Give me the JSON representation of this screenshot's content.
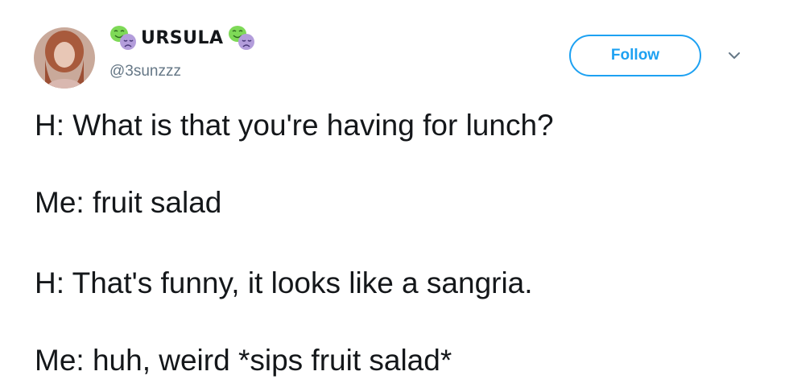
{
  "user": {
    "display_name": "URSULA",
    "handle": "@3sunzzz",
    "name_icons": [
      "theater-masks-icon",
      "theater-masks-icon"
    ]
  },
  "actions": {
    "follow_label": "Follow",
    "more_icon": "chevron-down-icon"
  },
  "tweet": {
    "lines": [
      "H: What is that you're having for lunch?",
      "Me: fruit salad",
      "H: That's funny, it looks like a sangria.",
      "Me: huh, weird *sips fruit salad*"
    ]
  },
  "colors": {
    "accent": "#1da1f2",
    "text": "#14171a",
    "secondary_text": "#657786",
    "mask_happy": "#7ed957",
    "mask_sad": "#b39ddb"
  }
}
